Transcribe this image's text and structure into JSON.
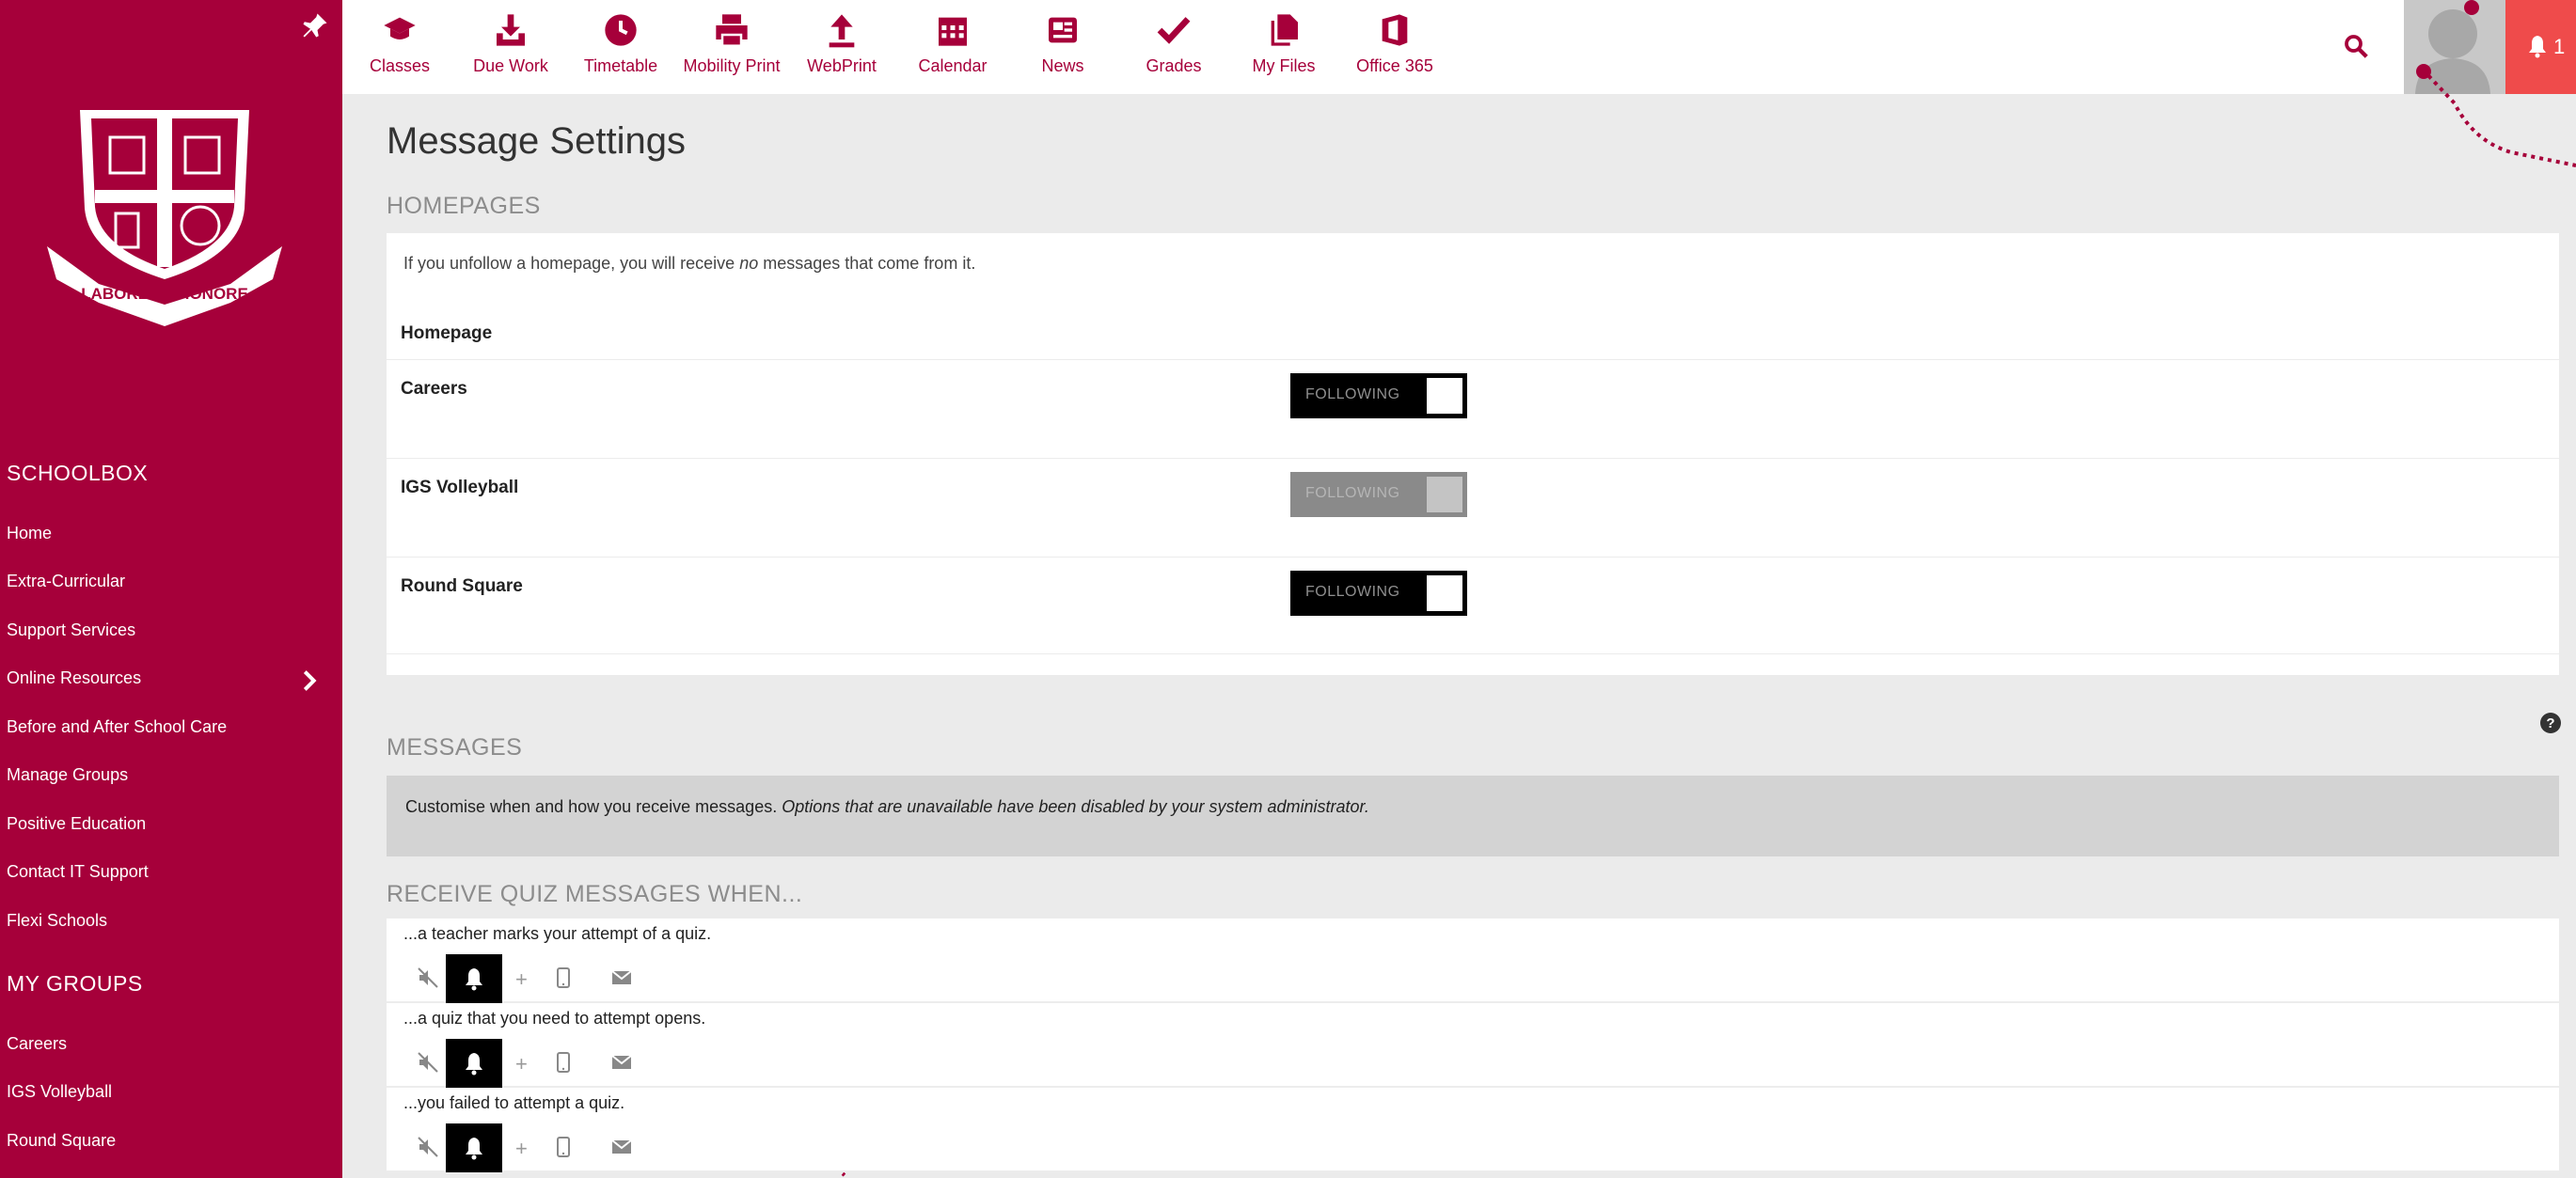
{
  "sidebar": {
    "section1": "SCHOOLBOX",
    "items1": [
      "Home",
      "Extra-Curricular",
      "Support Services",
      "Online Resources",
      "Before and After School Care",
      "Manage Groups",
      "Positive Education",
      "Contact IT Support",
      "Flexi Schools"
    ],
    "section2": "MY GROUPS",
    "items2": [
      "Careers",
      "IGS Volleyball",
      "Round Square"
    ],
    "crest_motto": "LABORE ET HONORE"
  },
  "nav": [
    "Classes",
    "Due Work",
    "Timetable",
    "Mobility Print",
    "WebPrint",
    "Calendar",
    "News",
    "Grades",
    "My Files",
    "Office 365"
  ],
  "notifications": {
    "count": "1"
  },
  "page_title": "Message Settings",
  "homepages": {
    "title": "HOMEPAGES",
    "note_before": "If you unfollow a homepage, you will receive ",
    "note_em": "no",
    "note_after": " messages that come from it.",
    "column_header": "Homepage",
    "rows": [
      {
        "name": "Careers",
        "status": "FOLLOWING",
        "enabled": true
      },
      {
        "name": "IGS Volleyball",
        "status": "FOLLOWING",
        "enabled": false
      },
      {
        "name": "Round Square",
        "status": "FOLLOWING",
        "enabled": true
      }
    ]
  },
  "messages": {
    "title": "MESSAGES",
    "info_text": "Customise when and how you receive messages. ",
    "info_em": "Options that are unavailable have been disabled by your system administrator."
  },
  "quiz": {
    "title": "RECEIVE QUIZ MESSAGES WHEN...",
    "rows": [
      {
        "label": "...a teacher marks your attempt of a quiz."
      },
      {
        "label": "...a quiz that you need to attempt opens."
      },
      {
        "label": "...you failed to attempt a quiz."
      }
    ],
    "options": [
      "mute-icon",
      "bell-icon",
      "plus-icon",
      "mobile-icon",
      "mail-icon"
    ],
    "plus_glyph": "+"
  },
  "colors": {
    "brand": "#a6003a",
    "alert": "#ef4b4b"
  }
}
